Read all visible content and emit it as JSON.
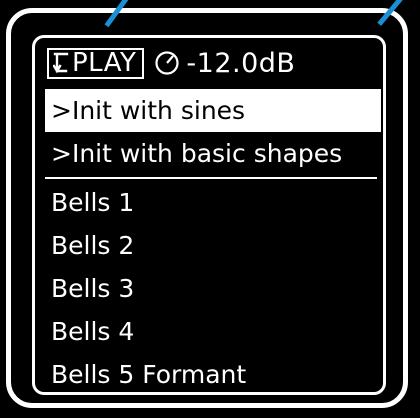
{
  "status": {
    "mode_label": "PLAY",
    "level": "-12.0dB"
  },
  "preset_list": {
    "init_items": [
      {
        "label": ">Init with sines",
        "selected": true
      },
      {
        "label": ">Init with basic shapes",
        "selected": false
      }
    ],
    "presets": [
      "Bells 1",
      "Bells 2",
      "Bells 3",
      "Bells 4",
      "Bells 5 Formant"
    ]
  },
  "icons": {
    "mode": "play-arrow-icon",
    "level": "dial-icon"
  },
  "colors": {
    "background": "#000000",
    "foreground": "#ffffff",
    "pointer": "#1b8fd6"
  }
}
